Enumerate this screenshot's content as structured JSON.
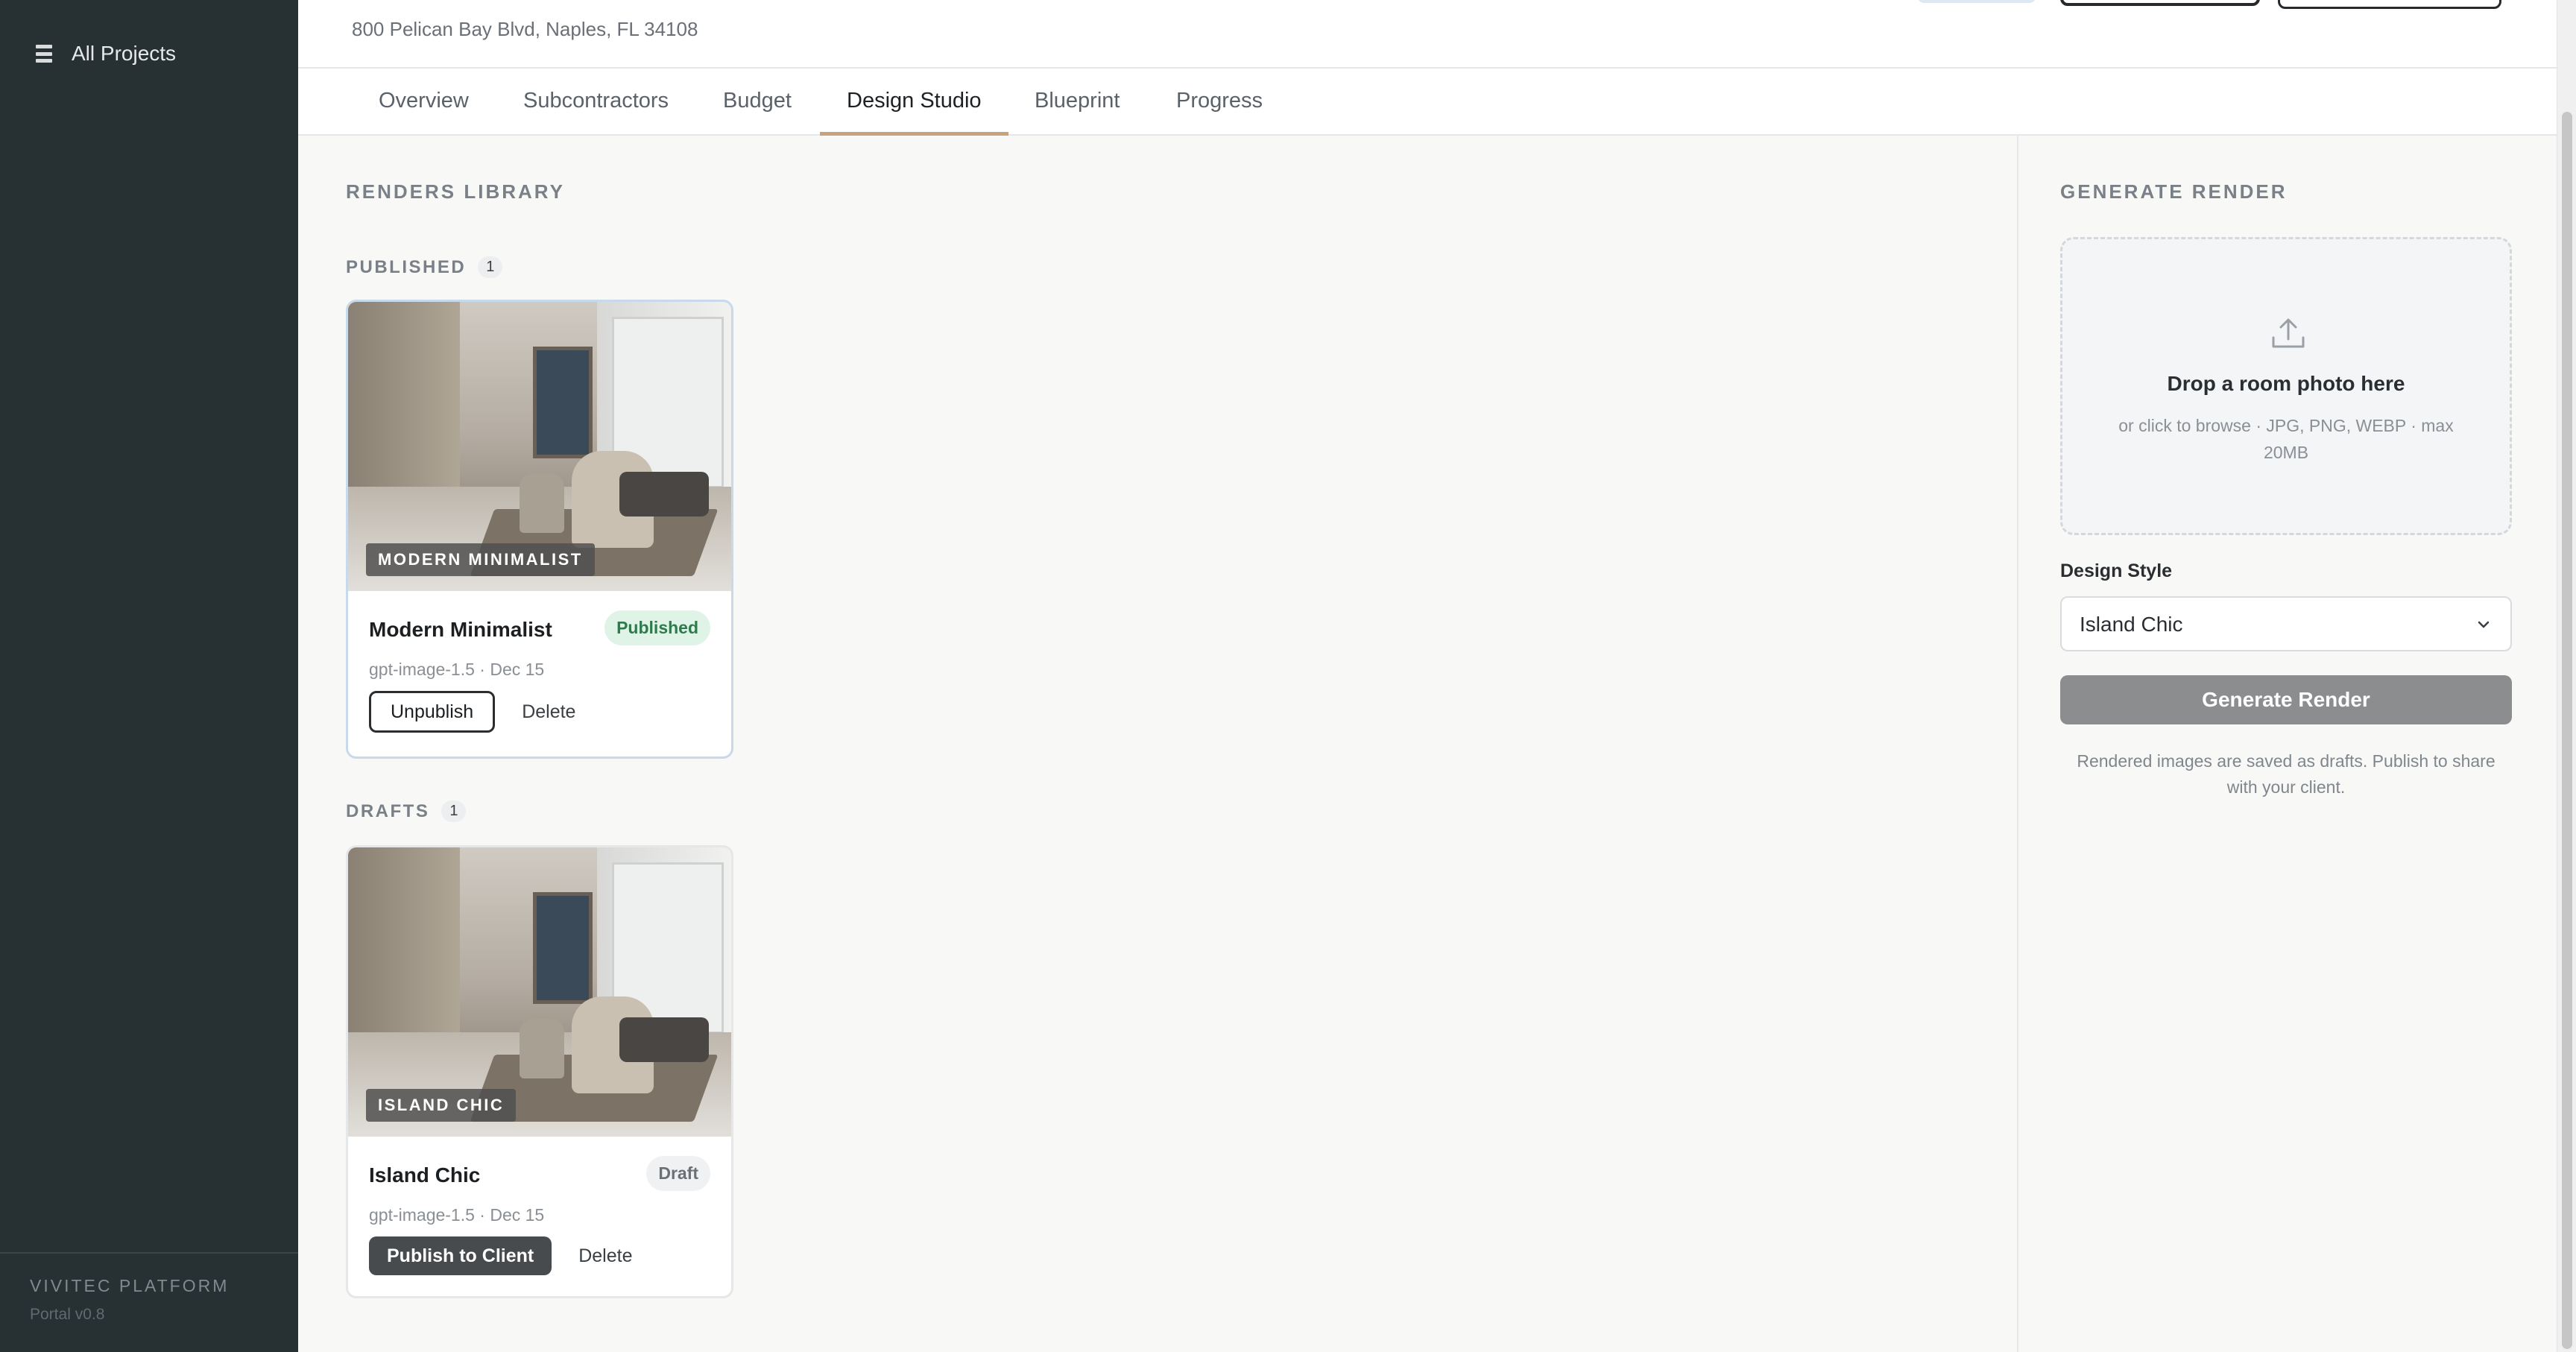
{
  "sidebar": {
    "all_projects": "All Projects",
    "brand": "VIVITEC PLATFORM",
    "version": "Portal v0.8"
  },
  "header": {
    "address": "800 Pelican Bay Blvd, Naples, FL 34108"
  },
  "tabs": [
    {
      "label": "Overview"
    },
    {
      "label": "Subcontractors"
    },
    {
      "label": "Budget"
    },
    {
      "label": "Design Studio",
      "active": true
    },
    {
      "label": "Blueprint"
    },
    {
      "label": "Progress"
    }
  ],
  "library": {
    "title": "RENDERS LIBRARY",
    "published": {
      "label": "PUBLISHED",
      "count": "1",
      "cards": [
        {
          "tag": "MODERN MINIMALIST",
          "title": "Modern Minimalist",
          "status": "Published",
          "meta": "gpt-image-1.5 · Dec 15",
          "primary_action": "Unpublish",
          "delete": "Delete"
        }
      ]
    },
    "drafts": {
      "label": "DRAFTS",
      "count": "1",
      "cards": [
        {
          "tag": "ISLAND CHIC",
          "title": "Island Chic",
          "status": "Draft",
          "meta": "gpt-image-1.5 · Dec 15",
          "primary_action": "Publish to Client",
          "delete": "Delete"
        }
      ]
    }
  },
  "generate": {
    "title": "GENERATE RENDER",
    "drop_main": "Drop a room photo here",
    "drop_sub": "or click to browse · JPG, PNG, WEBP · max 20MB",
    "style_label": "Design Style",
    "style_value": "Island Chic",
    "button": "Generate Render",
    "note": "Rendered images are saved as drafts. Publish to share with your client."
  },
  "colors": {
    "sidebar_bg": "#273133",
    "accent_tab": "#c8a27a",
    "published_badge_bg": "#dff3e7",
    "published_badge_text": "#2f7a4d"
  }
}
